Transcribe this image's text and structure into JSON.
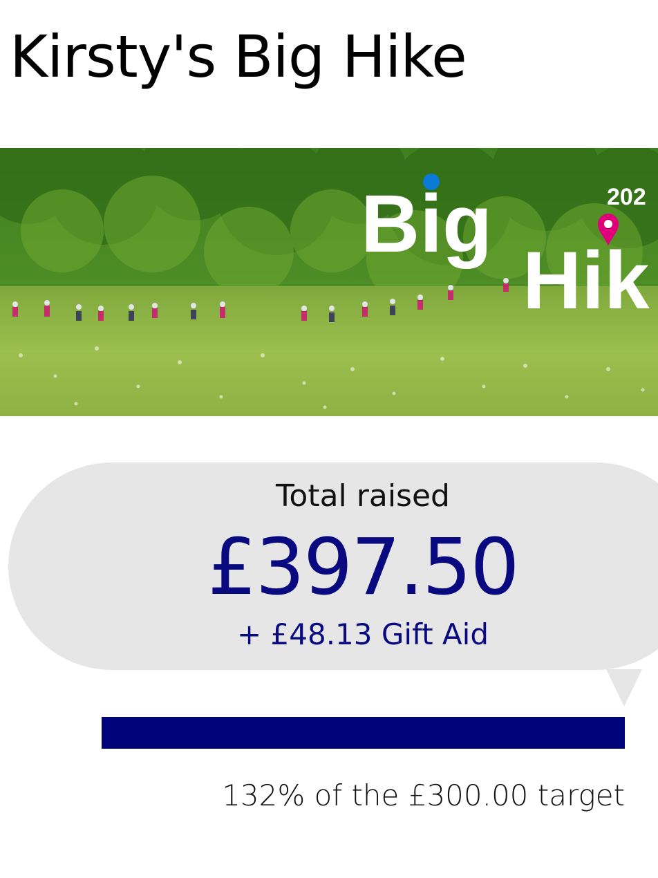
{
  "page": {
    "title": "Kirsty's Big Hike"
  },
  "banner": {
    "logo_text_top": "Big",
    "logo_text_bottom": "Hik",
    "logo_year": "202",
    "colors": {
      "logo_dot": "#0a7ad6",
      "logo_pin": "#e0007a"
    }
  },
  "fundraising": {
    "total_label": "Total raised",
    "total_amount": "£397.50",
    "gift_aid": "+ £48.13 Gift Aid",
    "progress_fraction": 1.0,
    "target_text": "132% of the £300.00 target"
  },
  "colors": {
    "accent": "#0a0a80",
    "progress": "#00047a",
    "bubble": "#e6e6e7"
  }
}
